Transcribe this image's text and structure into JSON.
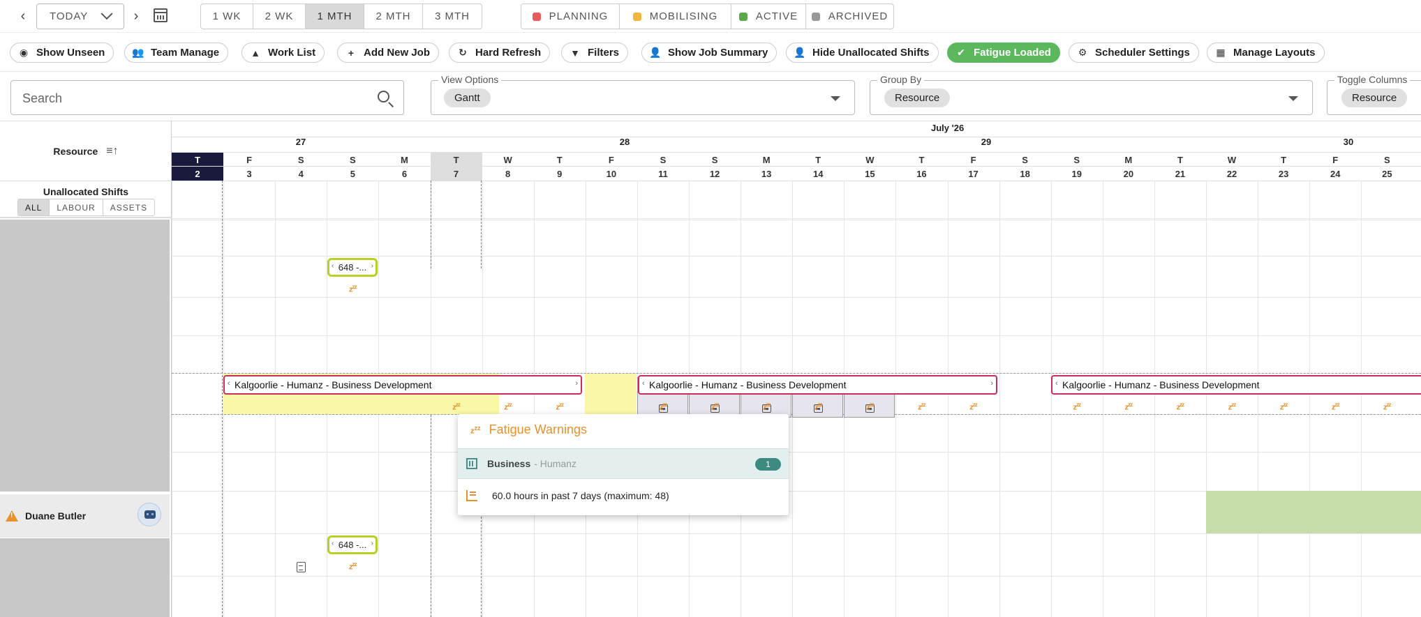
{
  "nav": {
    "prev_label": "‹",
    "next_label": "›",
    "today_label": "TODAY",
    "ranges": [
      "1 WK",
      "2 WK",
      "1 MTH",
      "2 MTH",
      "3 MTH"
    ],
    "active_range": "1 MTH",
    "statuses": [
      {
        "label": "PLANNING",
        "color": "#e85c5c"
      },
      {
        "label": "MOBILISING",
        "color": "#f0b640"
      },
      {
        "label": "ACTIVE",
        "color": "#5ca84a"
      },
      {
        "label": "ARCHIVED",
        "color": "#999999"
      }
    ]
  },
  "toolbar": {
    "show_unseen": "Show Unseen",
    "team_manage": "Team Manage",
    "work_list": "Work List",
    "add_new_job": "Add New Job",
    "hard_refresh": "Hard Refresh",
    "filters": "Filters",
    "show_job_summary": "Show Job Summary",
    "hide_unallocated": "Hide Unallocated Shifts",
    "fatigue_loaded": "Fatigue Loaded",
    "scheduler_settings": "Scheduler Settings",
    "manage_layouts": "Manage Layouts"
  },
  "filters": {
    "search_placeholder": "Search",
    "view_options_label": "View Options",
    "view_options_value": "Gantt",
    "group_by_label": "Group By",
    "group_by_value": "Resource",
    "toggle_columns_label": "Toggle Columns",
    "toggle_columns_value": "Resource"
  },
  "left": {
    "resource_header": "Resource",
    "unallocated_title": "Unallocated Shifts",
    "unallocated_tabs": [
      "ALL",
      "LABOUR",
      "ASSETS"
    ],
    "active_tab": "ALL",
    "person": "Duane Butler"
  },
  "calendar": {
    "month_label": "July '26",
    "weeks": [
      "27",
      "28",
      "29",
      "30"
    ],
    "days": [
      {
        "l": "T",
        "n": "2"
      },
      {
        "l": "F",
        "n": "3"
      },
      {
        "l": "S",
        "n": "4"
      },
      {
        "l": "S",
        "n": "5"
      },
      {
        "l": "M",
        "n": "6"
      },
      {
        "l": "T",
        "n": "7"
      },
      {
        "l": "W",
        "n": "8"
      },
      {
        "l": "T",
        "n": "9"
      },
      {
        "l": "F",
        "n": "10"
      },
      {
        "l": "S",
        "n": "11"
      },
      {
        "l": "S",
        "n": "12"
      },
      {
        "l": "M",
        "n": "13"
      },
      {
        "l": "T",
        "n": "14"
      },
      {
        "l": "W",
        "n": "15"
      },
      {
        "l": "T",
        "n": "16"
      },
      {
        "l": "F",
        "n": "17"
      },
      {
        "l": "S",
        "n": "18"
      },
      {
        "l": "S",
        "n": "19"
      },
      {
        "l": "M",
        "n": "20"
      },
      {
        "l": "T",
        "n": "21"
      },
      {
        "l": "W",
        "n": "22"
      },
      {
        "l": "T",
        "n": "23"
      },
      {
        "l": "F",
        "n": "24"
      },
      {
        "l": "S",
        "n": "25"
      }
    ]
  },
  "jobs": {
    "job_name": "Kalgoorlie - Humanz - Business Development",
    "chip_label": "648 -..."
  },
  "popup": {
    "title": "Fatigue Warnings",
    "business": "Business",
    "business_sub": "- Humanz",
    "count": "1",
    "message": "60.0 hours in past 7 days (maximum: 48)"
  },
  "colors": {
    "accent_job_border": "#cc2c5a",
    "chip_border": "#b8cf24",
    "fatigue_orange": "#e8902a",
    "fatigue_button": "#5cb85c",
    "today_header": "#1a1a3d"
  }
}
